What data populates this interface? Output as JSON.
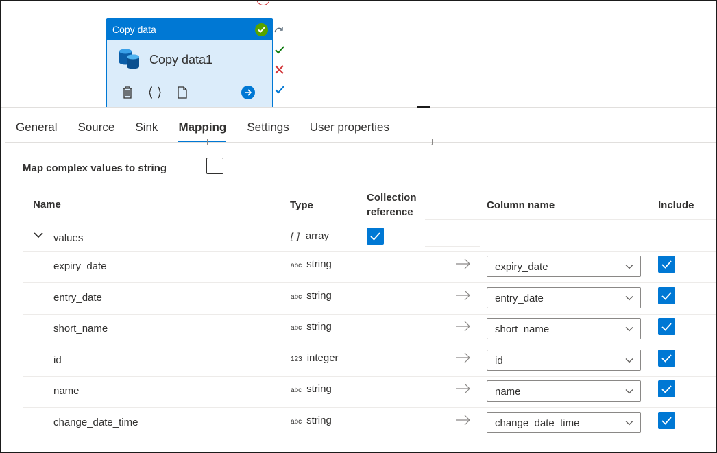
{
  "canvas": {
    "activity": {
      "header_label": "Copy data",
      "name": "Copy data1",
      "status": "succeeded"
    }
  },
  "tabs": [
    {
      "label": "General",
      "active": false
    },
    {
      "label": "Source",
      "active": false
    },
    {
      "label": "Sink",
      "active": false
    },
    {
      "label": "Mapping",
      "active": true
    },
    {
      "label": "Settings",
      "active": false
    },
    {
      "label": "User properties",
      "active": false
    }
  ],
  "options": {
    "map_complex_label": "Map complex values to string",
    "map_complex_checked": false
  },
  "table": {
    "headers": {
      "name": "Name",
      "type": "Type",
      "collection_line1": "Collection",
      "collection_line2": "reference",
      "column_name": "Column name",
      "include": "Include"
    },
    "parent": {
      "name": "values",
      "type_icon": "[ ]",
      "type": "array",
      "collection_reference": true
    },
    "rows": [
      {
        "name": "expiry_date",
        "type_icon": "abc",
        "type": "string",
        "column": "expiry_date",
        "include": true
      },
      {
        "name": "entry_date",
        "type_icon": "abc",
        "type": "string",
        "column": "entry_date",
        "include": true
      },
      {
        "name": "short_name",
        "type_icon": "abc",
        "type": "string",
        "column": "short_name",
        "include": true
      },
      {
        "name": "id",
        "type_icon": "123",
        "type": "integer",
        "column": "id",
        "include": true
      },
      {
        "name": "name",
        "type_icon": "abc",
        "type": "string",
        "column": "name",
        "include": true
      },
      {
        "name": "change_date_time",
        "type_icon": "abc",
        "type": "string",
        "column": "change_date_time",
        "include": true
      }
    ]
  },
  "colors": {
    "accent": "#0078d4",
    "success": "#57a300",
    "error": "#d13438",
    "activity_bg": "#dbecfa"
  }
}
